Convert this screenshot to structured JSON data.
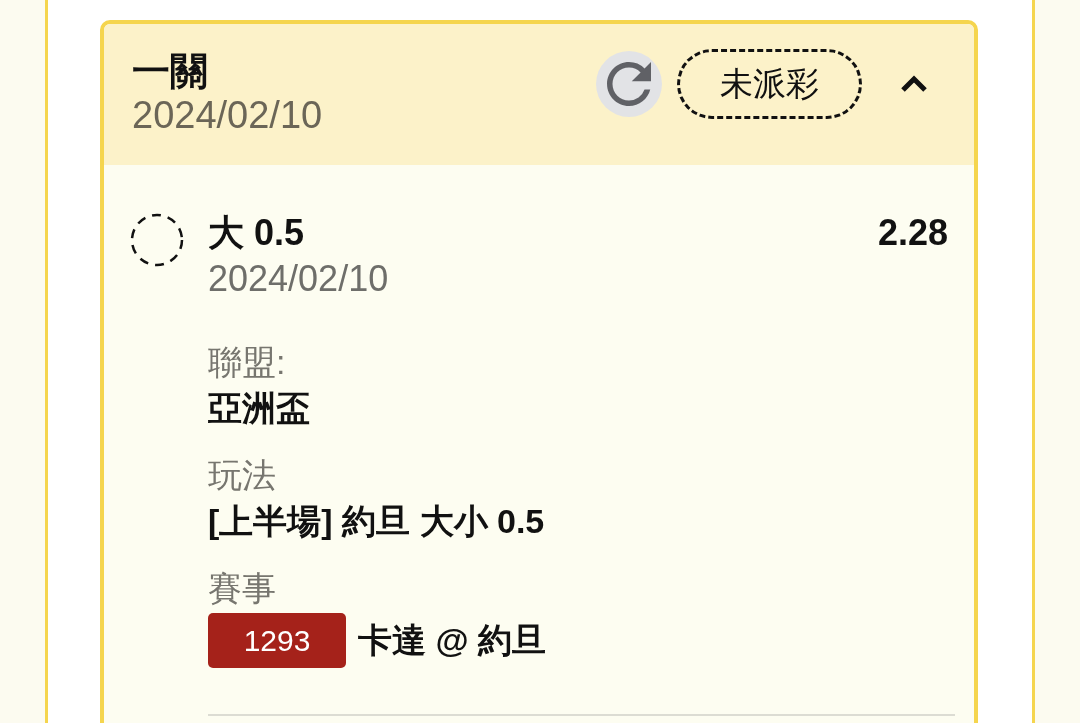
{
  "bet_card": {
    "title": "一關",
    "date": "2024/02/10",
    "status": "未派彩",
    "expanded": true,
    "selections": [
      {
        "checked": false,
        "pick": "大 0.5",
        "odds": "2.28",
        "date": "2024/02/10",
        "details": [
          {
            "label": "聯盟:",
            "value": "亞洲盃"
          },
          {
            "label": "玩法",
            "value": "[上半場] 約旦 大小 0.5"
          },
          {
            "label": "賽事",
            "match_no": "1293",
            "value": "卡達 @ 約旦"
          }
        ]
      }
    ]
  }
}
